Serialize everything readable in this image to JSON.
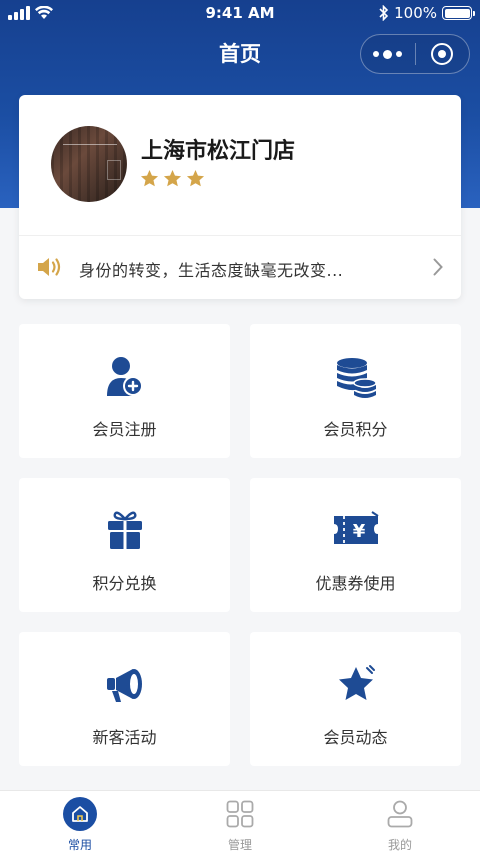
{
  "status_bar": {
    "time": "9:41 AM",
    "battery": "100%"
  },
  "nav": {
    "title": "首页"
  },
  "store": {
    "name": "上海市松江门店",
    "rating": 3,
    "notice": "身份的转变，生活态度缺毫无改变..."
  },
  "grid": [
    {
      "label": "会员注册",
      "icon": "add-member-icon"
    },
    {
      "label": "会员积分",
      "icon": "coins-icon"
    },
    {
      "label": "积分兑换",
      "icon": "gift-icon"
    },
    {
      "label": "优惠券使用",
      "icon": "coupon-icon"
    },
    {
      "label": "新客活动",
      "icon": "megaphone-icon"
    },
    {
      "label": "会员动态",
      "icon": "star-icon"
    }
  ],
  "tabbar": [
    {
      "label": "常用",
      "icon": "home-icon",
      "active": true
    },
    {
      "label": "管理",
      "icon": "grid-icon",
      "active": false
    },
    {
      "label": "我的",
      "icon": "user-icon",
      "active": false
    }
  ],
  "colors": {
    "brand": "#1b4ea3",
    "star": "#d4a54a",
    "icon": "#1e4b94"
  }
}
